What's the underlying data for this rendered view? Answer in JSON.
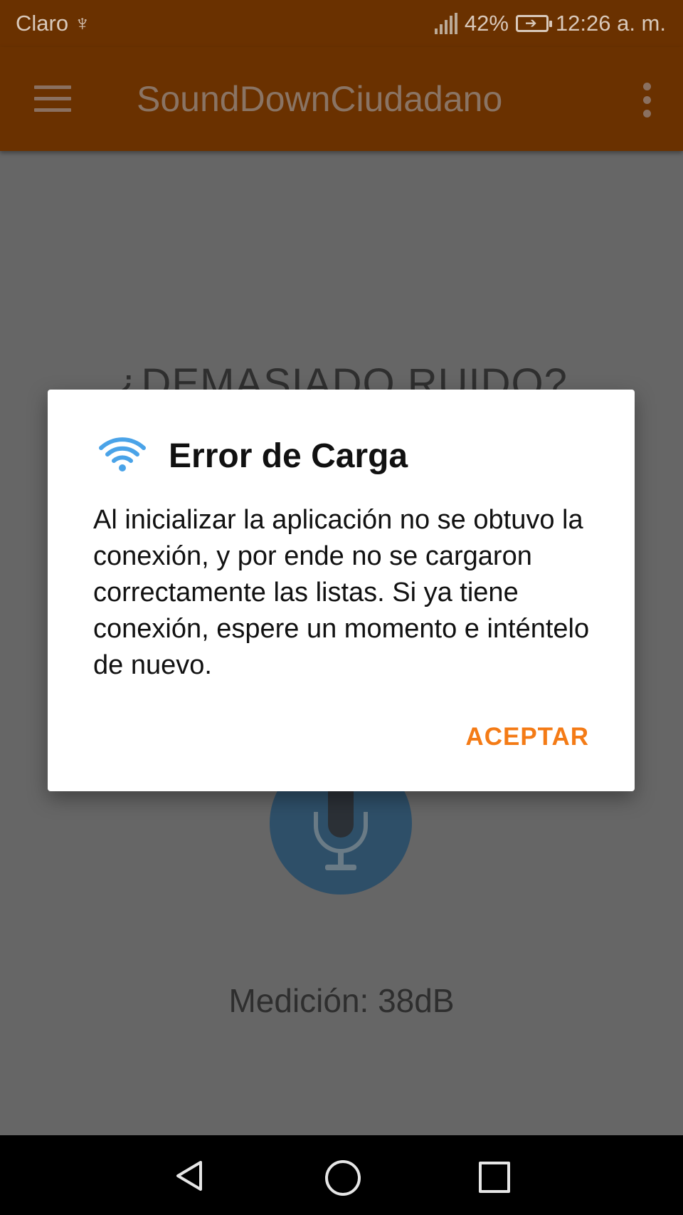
{
  "status_bar": {
    "carrier": "Claro",
    "usb_symbol": "♆",
    "battery_percent": "42%",
    "time": "12:26 a. m."
  },
  "app_bar": {
    "title": "SoundDownCiudadano",
    "menu_icon": "hamburger-icon",
    "overflow_icon": "more-vert-icon"
  },
  "main": {
    "heading": "¿DEMASIADO RUIDO?",
    "measurement": "Medición: 38dB",
    "mic_icon": "microphone-icon"
  },
  "dialog": {
    "icon": "wifi-icon",
    "title": "Error de Carga",
    "message": "Al inicializar la aplicación no se obtuvo la conexión, y por ende no se cargaron correctamente las listas. Si ya tiene conexión, espere un momento e inténtelo de nuevo.",
    "accept_label": "ACEPTAR"
  },
  "colors": {
    "app_bar": "#6a3100",
    "accent": "#f47b16",
    "mic_button": "#2e4f68",
    "wifi": "#4aa3e8"
  }
}
